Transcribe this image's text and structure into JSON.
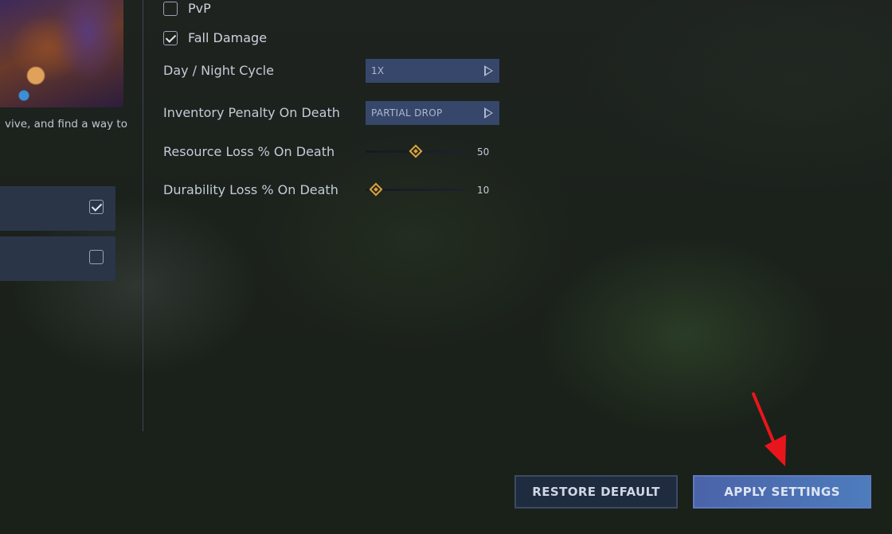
{
  "left_panel": {
    "description": "vive, and find a way to",
    "rows": [
      {
        "checked": true
      },
      {
        "checked": false
      }
    ]
  },
  "settings": {
    "pvp": {
      "label": "PvP",
      "checked": false
    },
    "fall_damage": {
      "label": "Fall Damage",
      "checked": true
    },
    "day_night": {
      "label": "Day / Night Cycle",
      "value": "1X"
    },
    "inventory_penalty": {
      "label": "Inventory Penalty On Death",
      "value": "PARTIAL DROP"
    },
    "resource_loss": {
      "label": "Resource Loss % On Death",
      "value": "50"
    },
    "durability_loss": {
      "label": "Durability Loss % On Death",
      "value": "10"
    }
  },
  "buttons": {
    "restore": "RESTORE DEFAULT",
    "apply": "APPLY SETTINGS"
  },
  "colors": {
    "accent": "#d9a441",
    "apply_button": "#4b63a8",
    "annotation_arrow": "#e8161c"
  }
}
